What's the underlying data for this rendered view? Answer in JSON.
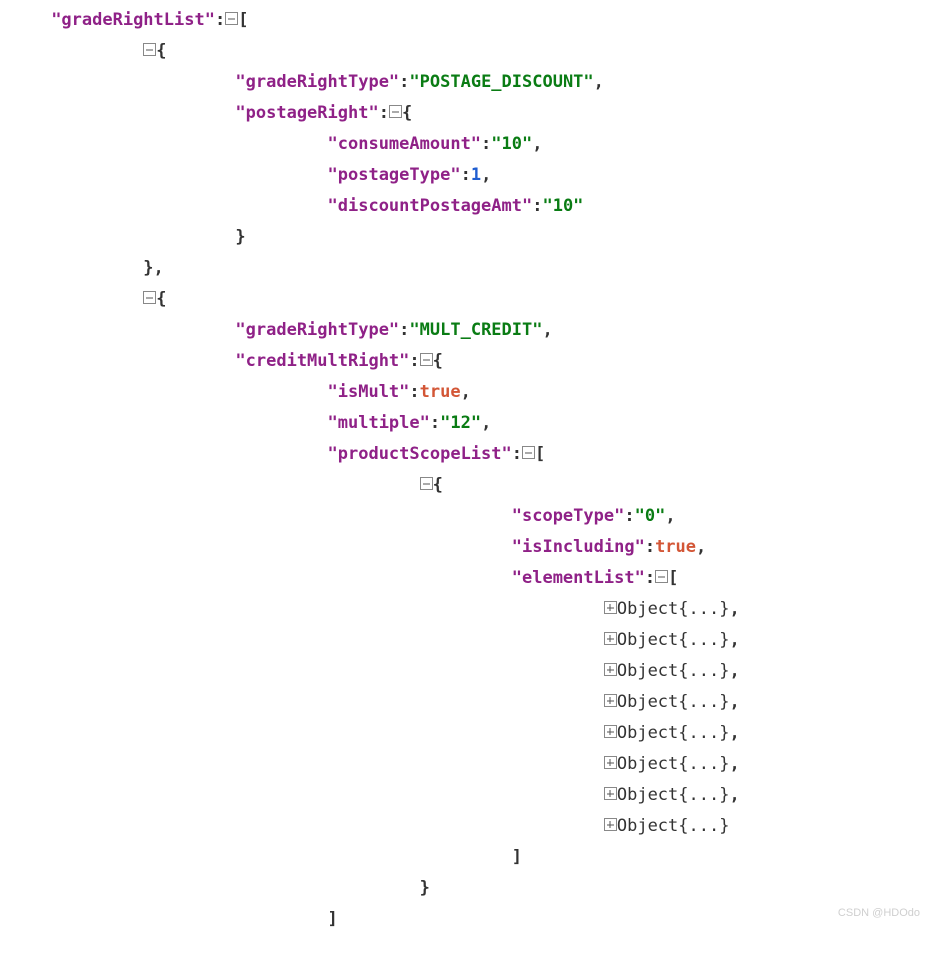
{
  "json": {
    "gradeRightList_key": "\"gradeRightList\"",
    "item0": {
      "gradeRightType": {
        "key": "\"gradeRightType\"",
        "value": "\"POSTAGE_DISCOUNT\""
      },
      "postageRight_key": "\"postageRight\"",
      "postageRight": {
        "consumeAmount": {
          "key": "\"consumeAmount\"",
          "value": "\"10\""
        },
        "postageType": {
          "key": "\"postageType\"",
          "value": "1"
        },
        "discountPostageAmt": {
          "key": "\"discountPostageAmt\"",
          "value": "\"10\""
        }
      }
    },
    "item1": {
      "gradeRightType": {
        "key": "\"gradeRightType\"",
        "value": "\"MULT_CREDIT\""
      },
      "creditMultRight_key": "\"creditMultRight\"",
      "creditMultRight": {
        "isMult": {
          "key": "\"isMult\"",
          "value": "true"
        },
        "multiple": {
          "key": "\"multiple\"",
          "value": "\"12\""
        },
        "productScopeList_key": "\"productScopeList\"",
        "productScopeList_item0": {
          "scopeType": {
            "key": "\"scopeType\"",
            "value": "\"0\""
          },
          "isIncluding": {
            "key": "\"isIncluding\"",
            "value": "true"
          },
          "elementList_key": "\"elementList\"",
          "elementList": {
            "obj0": "Object{...}",
            "obj1": "Object{...}",
            "obj2": "Object{...}",
            "obj3": "Object{...}",
            "obj4": "Object{...}",
            "obj5": "Object{...}",
            "obj6": "Object{...}",
            "obj7": "Object{...}"
          }
        }
      }
    }
  },
  "watermark": "CSDN @HDOdo"
}
